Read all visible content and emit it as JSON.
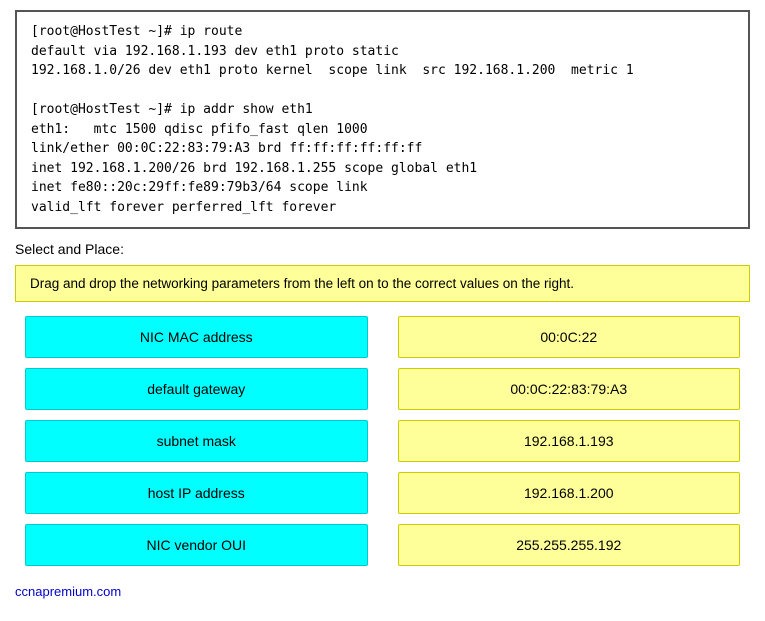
{
  "terminal": {
    "lines": "[root@HostTest ~]# ip route\ndefault via 192.168.1.193 dev eth1 proto static\n192.168.1.0/26 dev eth1 proto kernel  scope link  src 192.168.1.200  metric 1\n\n[root@HostTest ~]# ip addr show eth1\neth1:   mtc 1500 qdisc pfifo_fast qlen 1000\nlink/ether 00:0C:22:83:79:A3 brd ff:ff:ff:ff:ff:ff\ninet 192.168.1.200/26 brd 192.168.1.255 scope global eth1\ninet fe80::20c:29ff:fe89:79b3/64 scope link\nvalid_lft forever perferred_lft forever"
  },
  "select_label": "Select and Place:",
  "instruction": "Drag and drop the networking parameters from the left on to the correct values on the right.",
  "left_items": [
    "NIC MAC address",
    "default gateway",
    "subnet mask",
    "host IP address",
    "NIC vendor OUI"
  ],
  "right_items": [
    "00:0C:22",
    "00:0C:22:83:79:A3",
    "192.168.1.193",
    "192.168.1.200",
    "255.255.255.192"
  ],
  "footer": "ccnapremium.com"
}
